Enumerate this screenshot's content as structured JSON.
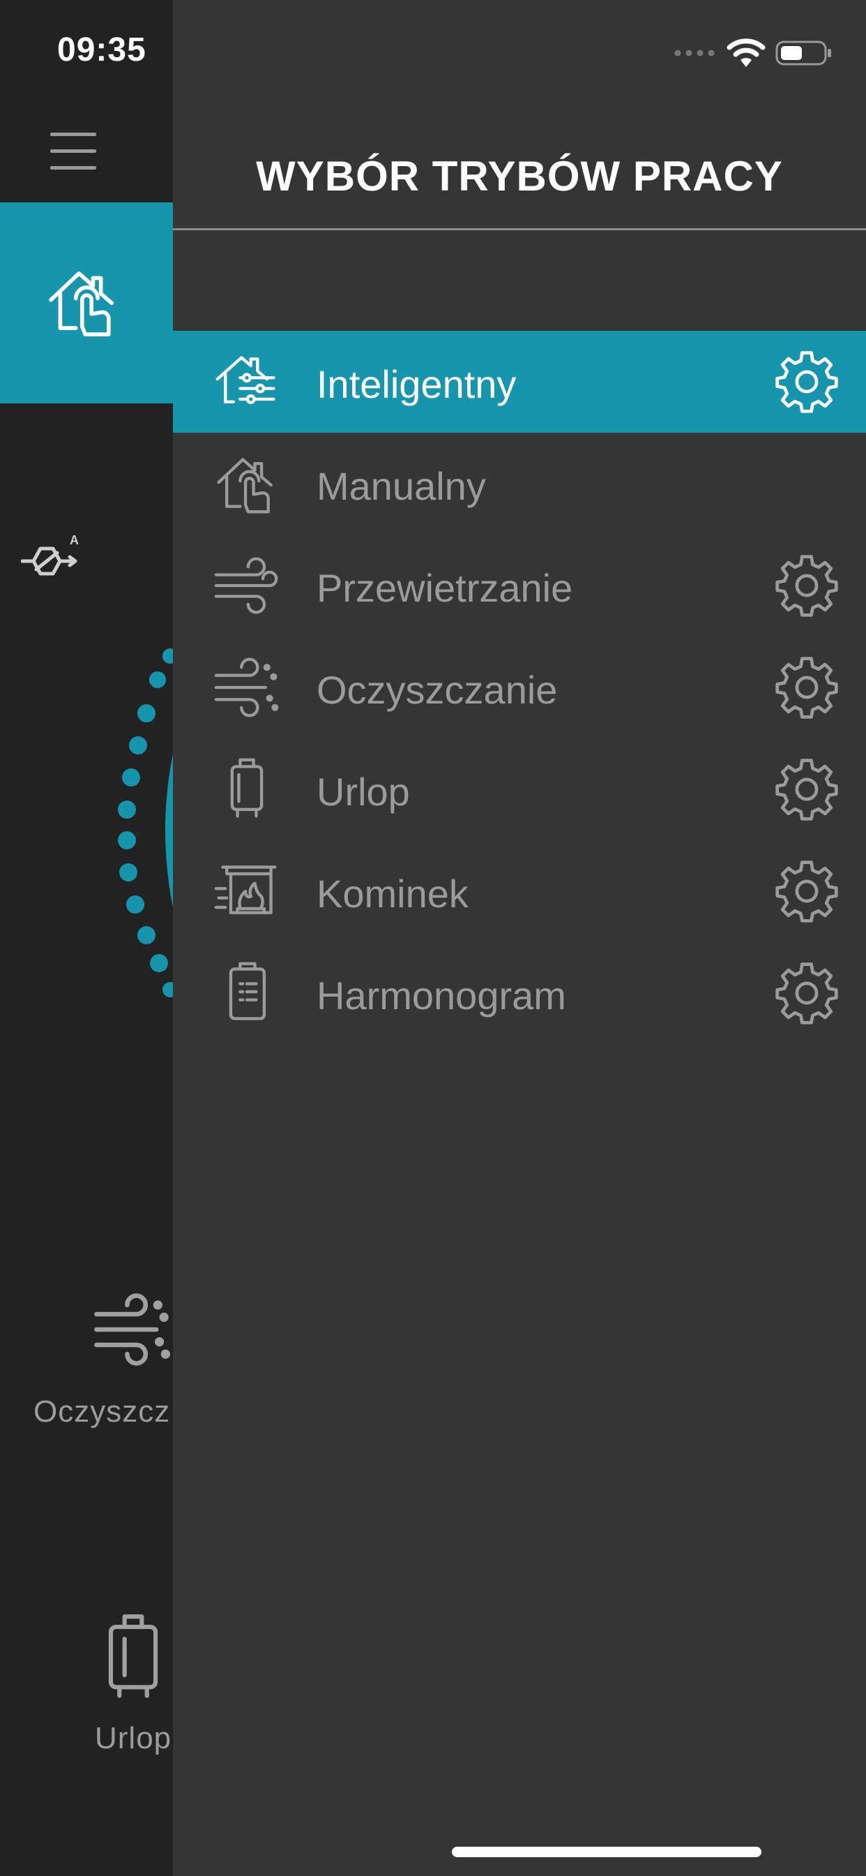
{
  "status_bar": {
    "time": "09:35"
  },
  "background_screen": {
    "tiles": [
      {
        "label": "Oczyszcz",
        "icon": "purify-icon"
      },
      {
        "label": "Urlop",
        "icon": "suitcase-icon"
      }
    ]
  },
  "drawer": {
    "title": "WYBÓR TRYBÓW PRACY",
    "modes": [
      {
        "label": "Inteligentny",
        "icon": "smart-home-icon",
        "active": true,
        "settings": true
      },
      {
        "label": "Manualny",
        "icon": "manual-home-icon",
        "active": false,
        "settings": false
      },
      {
        "label": "Przewietrzanie",
        "icon": "airing-icon",
        "active": false,
        "settings": true
      },
      {
        "label": "Oczyszczanie",
        "icon": "purify-icon",
        "active": false,
        "settings": true
      },
      {
        "label": "Urlop",
        "icon": "suitcase-icon",
        "active": false,
        "settings": true
      },
      {
        "label": "Kominek",
        "icon": "fireplace-icon",
        "active": false,
        "settings": true
      },
      {
        "label": "Harmonogram",
        "icon": "schedule-icon",
        "active": false,
        "settings": true
      }
    ]
  },
  "colors": {
    "accent": "#1795ac",
    "drawer_bg": "#353535",
    "page_bg": "#222222",
    "muted_text": "#9b9b9b"
  }
}
